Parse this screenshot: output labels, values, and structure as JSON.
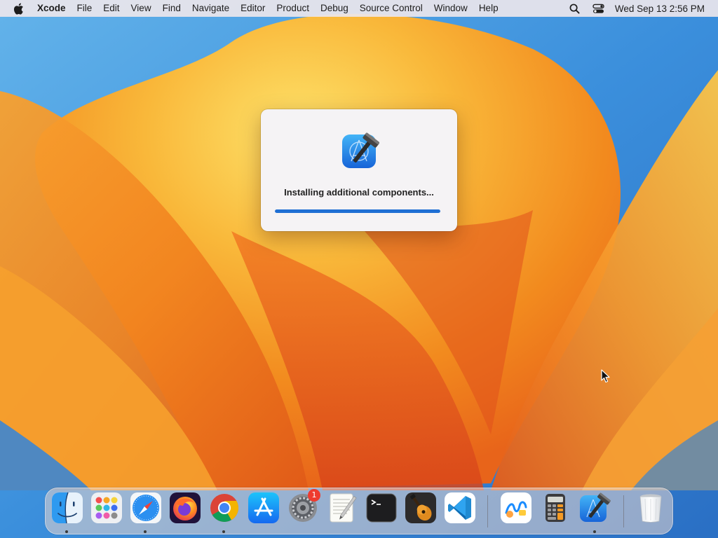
{
  "menubar": {
    "app_name": "Xcode",
    "items": [
      "File",
      "Edit",
      "View",
      "Find",
      "Navigate",
      "Editor",
      "Product",
      "Debug",
      "Source Control",
      "Window",
      "Help"
    ],
    "clock": "Wed Sep 13  2:56 PM",
    "status_icons": [
      "search-icon",
      "control-center-icon"
    ]
  },
  "dialog": {
    "icon": "xcode-app-icon",
    "message": "Installing additional components...",
    "progress_percent": 100
  },
  "dock": {
    "apps": [
      {
        "name": "finder",
        "icon": "finder-icon",
        "running": true
      },
      {
        "name": "launchpad",
        "icon": "launchpad-icon",
        "running": false
      },
      {
        "name": "safari",
        "icon": "safari-icon",
        "running": true
      },
      {
        "name": "firefox",
        "icon": "firefox-icon",
        "running": false
      },
      {
        "name": "chrome",
        "icon": "chrome-icon",
        "running": true
      },
      {
        "name": "app-store",
        "icon": "app-store-icon",
        "running": false
      },
      {
        "name": "system-settings",
        "icon": "system-settings-icon",
        "running": false,
        "badge": "1"
      },
      {
        "name": "textedit",
        "icon": "textedit-icon",
        "running": false
      },
      {
        "name": "terminal",
        "icon": "terminal-icon",
        "running": false
      },
      {
        "name": "garageband",
        "icon": "garageband-icon",
        "running": false
      },
      {
        "name": "vscode",
        "icon": "vscode-icon",
        "running": false
      },
      {
        "name": "freeform",
        "icon": "freeform-icon",
        "running": false
      },
      {
        "name": "calculator",
        "icon": "calculator-icon",
        "running": false
      },
      {
        "name": "xcode",
        "icon": "xcode-icon",
        "running": true
      },
      {
        "name": "trash",
        "icon": "trash-icon",
        "running": false
      }
    ]
  },
  "colors": {
    "progress": "#1f6fd4",
    "wallpaper_orange": "#f08a1c",
    "wallpaper_blue": "#3b8fdc",
    "badge": "#ee3b2f"
  }
}
